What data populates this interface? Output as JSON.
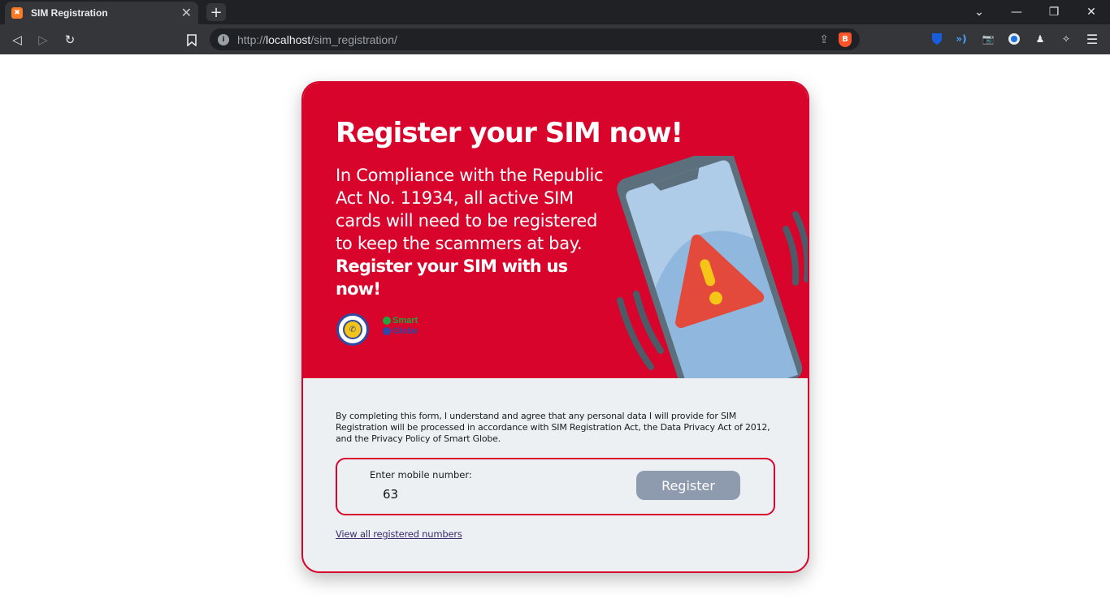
{
  "browser": {
    "tab_title": "SIM Registration",
    "tab_favicon": "xampp-icon",
    "new_tab_label": "+",
    "url_prefix": "http://",
    "url_host": "localhost",
    "url_path": "/sim_registration/",
    "accent": "#fb542b"
  },
  "hero": {
    "title": "Register your SIM now!",
    "text_plain": "In Compliance with the Republic Act No. 11934, all active SIM cards will need to be registered to keep the scammers at bay.",
    "text_bold": "Register your SIM with us now!",
    "logo_smart": "Smart",
    "logo_globe": "Globe",
    "background": "#d9042b"
  },
  "form": {
    "consent": "By completing this form, I understand and agree that any personal data I will provide for SIM Registration will be processed in accordance with SIM Registration Act, the Data Privacy Act of 2012, and the Privacy Policy of Smart Globe.",
    "label": "Enter mobile number:",
    "value": "63",
    "button": "Register",
    "link": "View all registered numbers"
  }
}
